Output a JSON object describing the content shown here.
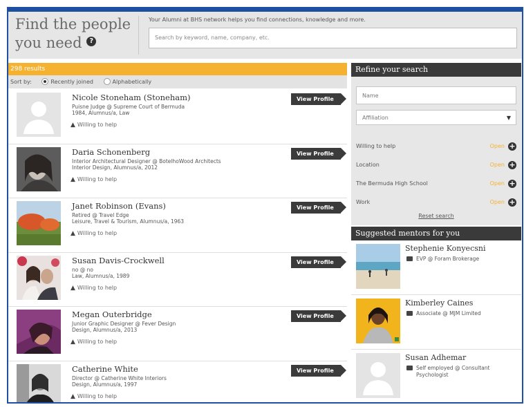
{
  "header": {
    "headline_line1": "Find the people",
    "headline_line2": "you need",
    "help_glyph": "?",
    "tagline": "Your Alumni at BHS network helps you find connections, knowledge and more.",
    "search_placeholder": "Search by keyword, name, company, etc."
  },
  "results": {
    "count_label": "298 results",
    "sort_label": "Sort by:",
    "sort_options": [
      "Recently joined",
      "Alphabetically"
    ],
    "sort_selected": "Recently joined"
  },
  "people": [
    {
      "name": "Nicole Stoneham (Stoneham)",
      "role": "Puisne Judge @ Supreme Court of Bermuda",
      "detail": "1984, Alumnus/a, Law",
      "willing": "Willing to help",
      "button": "View Profile",
      "photo": "placeholder-avatar"
    },
    {
      "name": "Daria Schonenberg",
      "role": "Interior Architectural Designer @ BotelhoWood Architects",
      "detail": "Interior Design, Alumnus/a, 2012",
      "willing": "Willing to help",
      "button": "View Profile",
      "photo": "portrait-photo"
    },
    {
      "name": "Janet Robinson (Evans)",
      "role": "Retired @ Travel Edge",
      "detail": "Leisure, Travel & Tourism, Alumnus/a, 1963",
      "willing": "Willing to help",
      "button": "View Profile",
      "photo": "flowers-photo"
    },
    {
      "name": "Susan Davis-Crockwell",
      "role": "no @ no",
      "detail": "Law, Alumnus/a, 1989",
      "willing": "Willing to help",
      "button": "View Profile",
      "photo": "portrait-photo"
    },
    {
      "name": "Megan Outerbridge",
      "role": "Junior Graphic Designer @ Fever Design",
      "detail": "Design, Alumnus/a, 2013",
      "willing": "Willing to help",
      "button": "View Profile",
      "photo": "portrait-photo"
    },
    {
      "name": "Catherine White",
      "role": "Director @ Catherine White Interiors",
      "detail": "Design, Alumnus/a, 1997",
      "willing": "Willing to help",
      "button": "View Profile",
      "photo": "portrait-photo"
    }
  ],
  "refine": {
    "heading": "Refine your search",
    "name_placeholder": "Name",
    "affiliation_label": "Affiliation",
    "facets": [
      {
        "label": "Willing to help",
        "action": "Open"
      },
      {
        "label": "Location",
        "action": "Open"
      },
      {
        "label": "The Bermuda High School",
        "action": "Open"
      },
      {
        "label": "Work",
        "action": "Open"
      }
    ],
    "reset_label": "Reset search"
  },
  "mentors": {
    "heading": "Suggested mentors for you",
    "items": [
      {
        "name": "Stephenie Konyecsni",
        "role": "EVP @ Foram Brokerage",
        "photo": "beach-photo"
      },
      {
        "name": "Kimberley Caines",
        "role": "Associate @ MJM Limited",
        "photo": "portrait-photo"
      },
      {
        "name": "Susan Adhemar",
        "role": "Self employed @ Consultant Psychologist",
        "photo": "placeholder-avatar"
      }
    ]
  },
  "colors": {
    "accent": "#f4b230",
    "dark": "#3a3a3a",
    "frame": "#1f4fa0"
  }
}
